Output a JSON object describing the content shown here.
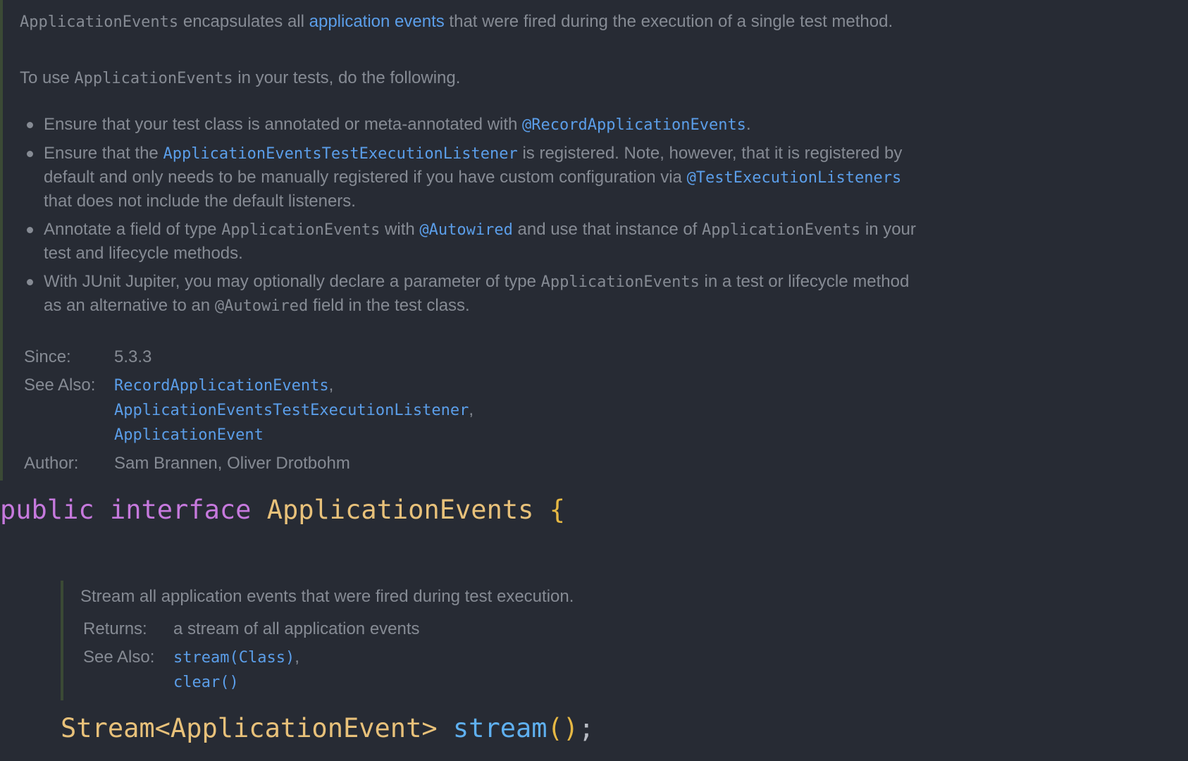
{
  "class_doc": {
    "para1": {
      "code_name": "ApplicationEvents",
      "text_a": " encapsulates all ",
      "link": "application events",
      "text_b": " that were fired during the execution of a single test method."
    },
    "para2": {
      "text_a": "To use ",
      "code_name": "ApplicationEvents",
      "text_b": " in your tests, do the following."
    },
    "bullets": [
      {
        "text_a": "Ensure that your test class is annotated or meta-annotated with ",
        "link": "@RecordApplicationEvents",
        "text_b": "."
      },
      {
        "text_a": "Ensure that the ",
        "link": "ApplicationEventsTestExecutionListener",
        "text_b": " is registered. Note, however, that it is registered by default and only needs to be manually registered if you have custom configuration via ",
        "link2": "@TestExecutionListeners",
        "text_c": " that does not include the default listeners."
      },
      {
        "text_a": "Annotate a field of type ",
        "code_a": "ApplicationEvents",
        "text_b": " with ",
        "link": "@Autowired",
        "text_c": " and use that instance of ",
        "code_b": "ApplicationEvents",
        "text_d": " in your test and lifecycle methods."
      },
      {
        "text_a": "With JUnit Jupiter, you may optionally declare a parameter of type ",
        "code_a": "ApplicationEvents",
        "text_b": " in a test or lifecycle method as an alternative to an ",
        "code_b": "@Autowired",
        "text_c": " field in the test class."
      }
    ],
    "since_label": "Since:",
    "since_value": "5.3.3",
    "see_also_label": "See Also:",
    "see_also": [
      "RecordApplicationEvents",
      "ApplicationEventsTestExecutionListener",
      "ApplicationEvent"
    ],
    "comma": ",",
    "author_label": "Author:",
    "author_value": "Sam Brannen, Oliver Drotbohm"
  },
  "interface_line": {
    "kw_public": "public",
    "kw_interface": "interface",
    "name": "ApplicationEvents",
    "brace": "{"
  },
  "method_doc": {
    "summary": "Stream all application events that were fired during test execution.",
    "returns_label": "Returns:",
    "returns_value": "a stream of all application events",
    "see_also_label": "See Also:",
    "see_also": [
      "stream(Class)",
      "clear()"
    ]
  },
  "stream_line": {
    "return_type": "Stream<ApplicationEvent>",
    "method": "stream",
    "parens": "()",
    "semicolon": ";"
  },
  "colors": {
    "background": "#272b34",
    "doc_text": "#868b94",
    "link": "#5b9ee9",
    "keyword": "#c679dd",
    "type": "#e8c17a",
    "method": "#5fb0f0",
    "doc_border": "#3b4a35"
  }
}
